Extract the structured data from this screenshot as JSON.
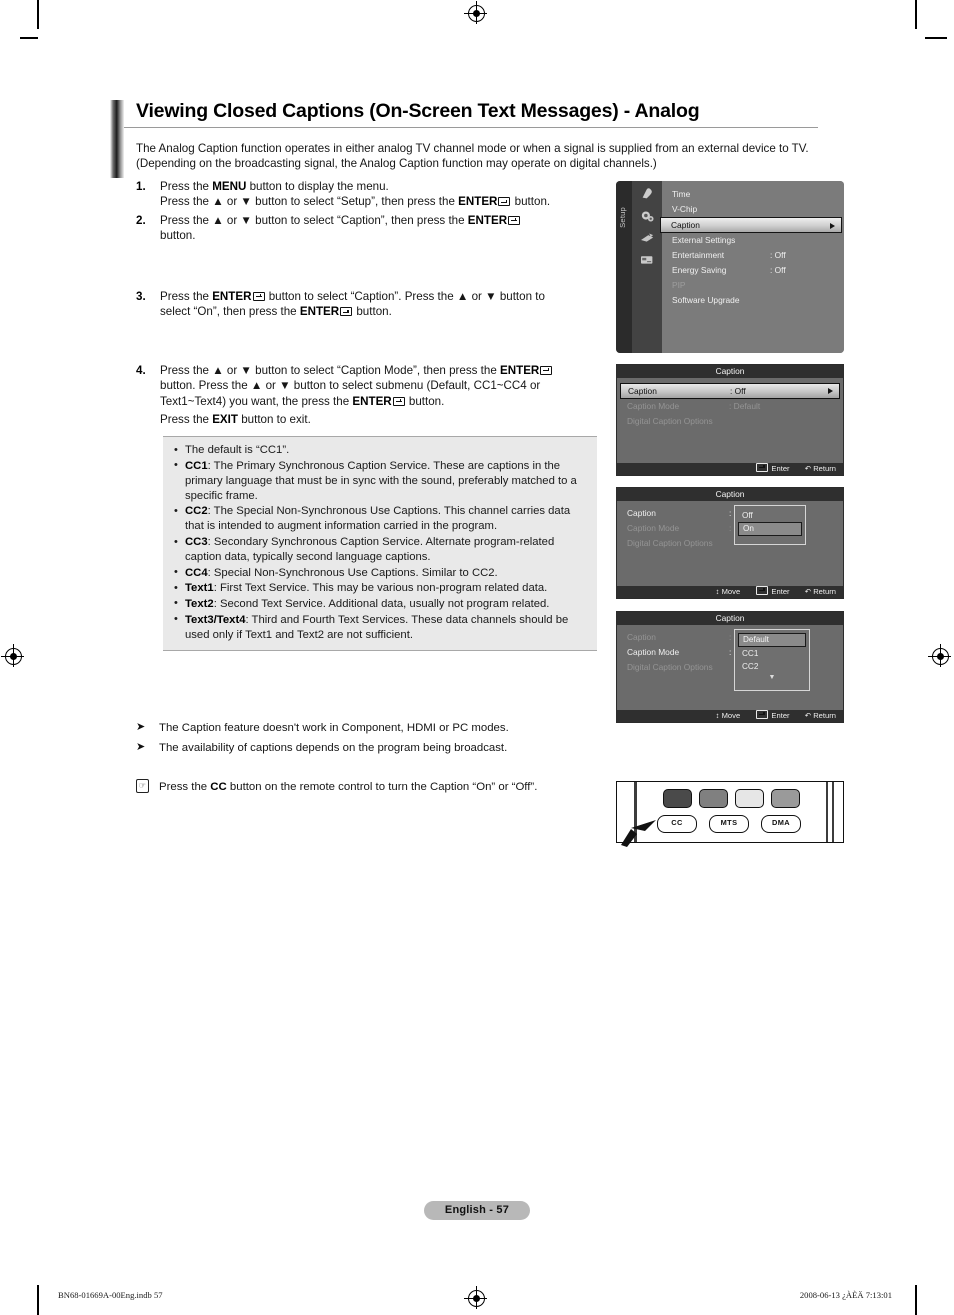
{
  "document": {
    "title": "Viewing Closed Captions (On-Screen Text Messages) - Analog",
    "intro": "The Analog Caption function operates in either analog TV channel mode or when a signal is supplied from an external device to TV. (Depending on the broadcasting signal, the Analog Caption function may operate on digital channels.)",
    "page_badge": "English - 57",
    "footer_left": "BN68-01669A-00Eng.indb   57",
    "footer_right": "2008-06-13   ¿ÀÈÄ 7:13:01"
  },
  "steps": [
    {
      "num": "1.",
      "lines": [
        {
          "pre": "Press the ",
          "b1": "MENU",
          "mid": " button to display the menu.",
          "post": "",
          "icon": false
        },
        {
          "pre": "Press the ▲ or ▼ button to select “Setup”, then press the ",
          "b1": "ENTER",
          "mid": "",
          "post": " button.",
          "icon": true
        }
      ]
    },
    {
      "num": "2.",
      "lines": [
        {
          "pre": "Press the ▲ or ▼ button to select “Caption”, then press the ",
          "b1": "ENTER",
          "mid": "",
          "post": "",
          "icon": true
        },
        {
          "pre": "button.",
          "b1": "",
          "mid": "",
          "post": "",
          "icon": false
        }
      ]
    },
    {
      "num": "3.",
      "lines": [
        {
          "pre": "Press the ",
          "b1": "ENTER",
          "mid": "",
          "post": " button to select “Caption”. Press the ▲ or ▼ button to",
          "icon": true
        },
        {
          "pre": "select “On”, then press the ",
          "b1": "ENTER",
          "mid": "",
          "post": " button.",
          "icon": true
        }
      ]
    },
    {
      "num": "4.",
      "lines": [
        {
          "pre": "Press the ▲ or ▼ button to select “Caption Mode”, then press the ",
          "b1": "ENTER",
          "mid": "",
          "post": "",
          "icon": true
        },
        {
          "pre": "button. Press the ▲ or ▼ button to select submenu (Default, CC1~CC4 or",
          "b1": "",
          "mid": "",
          "post": "",
          "icon": false
        },
        {
          "pre": "Text1~Text4) you want, the press the ",
          "b1": "ENTER",
          "mid": "",
          "post": " button.",
          "icon": true
        },
        {
          "pre": "Press the ",
          "b1": "EXIT",
          "mid": " button to exit.",
          "post": "",
          "icon": false
        }
      ]
    }
  ],
  "note_box": {
    "items": [
      {
        "label": "",
        "text": "The default is “CC1”."
      },
      {
        "label": "CC1",
        "text": ": The Primary Synchronous Caption Service. These are captions in the primary language that must be in sync with the sound, preferably matched to a specific frame."
      },
      {
        "label": "CC2",
        "text": ": The Special Non-Synchronous Use Captions. This channel carries data that is intended to augment information carried in the program."
      },
      {
        "label": "CC3",
        "text": ": Secondary Synchronous Caption Service. Alternate program-related caption data, typically second language captions."
      },
      {
        "label": "CC4",
        "text": ": Special Non-Synchronous Use Captions. Similar to CC2."
      },
      {
        "label": "Text1",
        "text": ": First Text Service. This may be various non-program related data."
      },
      {
        "label": "Text2",
        "text": ": Second Text Service. Additional data, usually not program related."
      },
      {
        "label": "Text3/Text4",
        "text": ": Third and Fourth Text Services. These data channels should be used only if Text1 and Text2 are not sufficient."
      }
    ]
  },
  "arrow_notes": [
    "The Caption feature doesn't work in Component, HDMI or PC modes.",
    "The availability of captions depends on the program being broadcast."
  ],
  "remote_note": {
    "pre": "Press the ",
    "bold": "CC",
    "post": " button on the remote control to turn the Caption “On” or “Off”."
  },
  "osd_setup_menu": {
    "tab_label": "Setup",
    "rows": [
      {
        "label": "Time",
        "value": "",
        "state": "normal"
      },
      {
        "label": "V-Chip",
        "value": "",
        "state": "normal"
      },
      {
        "label": "Caption",
        "value": "",
        "state": "selected"
      },
      {
        "label": "External Settings",
        "value": "",
        "state": "normal"
      },
      {
        "label": "Entertainment",
        "value": ": Off",
        "state": "normal"
      },
      {
        "label": "Energy Saving",
        "value": ": Off",
        "state": "normal"
      },
      {
        "label": "PIP",
        "value": "",
        "state": "disabled"
      },
      {
        "label": "Software Upgrade",
        "value": "",
        "state": "normal"
      }
    ]
  },
  "osd_caption_1": {
    "header": "Caption",
    "rows": [
      {
        "label": "Caption",
        "value": ": Off",
        "state": "selected"
      },
      {
        "label": "Caption Mode",
        "value": ": Default",
        "state": "disabled"
      },
      {
        "label": "Digital Caption Options",
        "value": "",
        "state": "disabled"
      }
    ],
    "footer": [
      {
        "icon": "enter-icon",
        "label": "Enter"
      },
      {
        "icon": "return-icon",
        "label": "Return"
      }
    ]
  },
  "osd_caption_2": {
    "header": "Caption",
    "rows": [
      {
        "label": "Caption",
        "value": ":",
        "state": "normal"
      },
      {
        "label": "Caption Mode",
        "value": ":",
        "state": "disabled"
      },
      {
        "label": "Digital Caption Options",
        "value": "",
        "state": "disabled"
      }
    ],
    "dropdown": {
      "options": [
        {
          "label": "Off",
          "highlighted": false
        },
        {
          "label": "On",
          "highlighted": true
        }
      ],
      "more": false
    },
    "footer": [
      {
        "icon": "move-icon",
        "label": "Move"
      },
      {
        "icon": "enter-icon",
        "label": "Enter"
      },
      {
        "icon": "return-icon",
        "label": "Return"
      }
    ]
  },
  "osd_caption_3": {
    "header": "Caption",
    "rows": [
      {
        "label": "Caption",
        "value": ":",
        "state": "disabled"
      },
      {
        "label": "Caption Mode",
        "value": ":",
        "state": "normal"
      },
      {
        "label": "Digital Caption Options",
        "value": "",
        "state": "disabled"
      }
    ],
    "dropdown": {
      "options": [
        {
          "label": "Default",
          "highlighted": true
        },
        {
          "label": "CC1",
          "highlighted": false
        },
        {
          "label": "CC2",
          "highlighted": false
        }
      ],
      "more": true
    },
    "footer": [
      {
        "icon": "move-icon",
        "label": "Move"
      },
      {
        "icon": "enter-icon",
        "label": "Enter"
      },
      {
        "icon": "return-icon",
        "label": "Return"
      }
    ]
  },
  "remote_figure": {
    "buttons": [
      {
        "label": "CC"
      },
      {
        "label": "MTS"
      },
      {
        "label": "DMA"
      }
    ],
    "color_keys": [
      "#4a4a4a",
      "#808080",
      "#e6e6e6",
      "#9a9a9a"
    ]
  }
}
